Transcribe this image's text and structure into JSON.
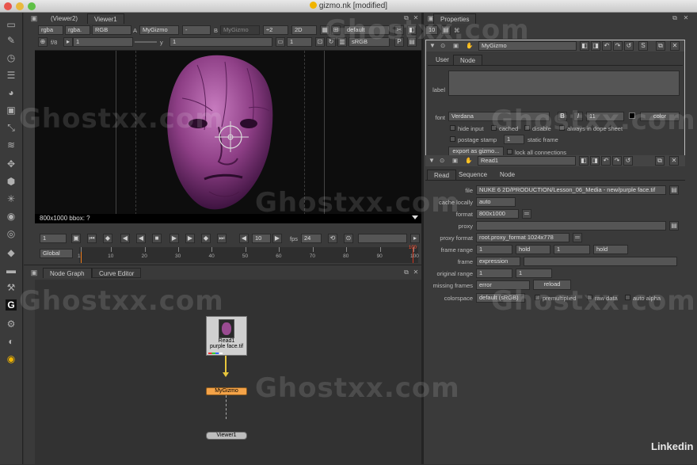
{
  "window": {
    "title": "gizmo.nk [modified]"
  },
  "viewer": {
    "tabs": [
      "(Viewer2)",
      "Viewer1"
    ],
    "row1": {
      "channels": "rgba",
      "alpha": "rgba.",
      "colorspace": "RGB",
      "a_label": "A",
      "a_input": "MyGizmo",
      "a_extra": "-",
      "b_label": "B",
      "b_input": "MyGizmo",
      "zoom": "÷2",
      "view": "2D",
      "lut_default": "default"
    },
    "row2": {
      "fstop": "f/8",
      "gain": "1",
      "y_label": "y",
      "gamma": "1",
      "proxy": "1",
      "display": "sRGB"
    },
    "info": "800x1000  bbox: ?"
  },
  "timeline": {
    "frame": "1",
    "step": "10",
    "fps_label": "fps",
    "fps": "24",
    "range_mode": "Global",
    "ticks": [
      "1",
      "10",
      "20",
      "30",
      "40",
      "50",
      "60",
      "70",
      "80",
      "90",
      "100"
    ],
    "end_marker": "100"
  },
  "graph": {
    "tabs": [
      "Node Graph",
      "Curve Editor"
    ],
    "nodes": {
      "read_name": "Read1",
      "read_file": "purple face.tif",
      "gizmo": "MyGizmo",
      "viewer": "Viewer1"
    }
  },
  "properties": {
    "title": "Properties",
    "max_panels": "10",
    "gizmo": {
      "name": "MyGizmo",
      "tabs": [
        "User",
        "Node"
      ],
      "label_label": "label",
      "font_label": "font",
      "font": "Verdana",
      "bold": "B",
      "italic": "I",
      "font_size": "11",
      "color_label": "color",
      "hide_input": "hide input",
      "cached": "cached",
      "disable": "disable",
      "dope_sheet": "always in dope sheet",
      "postage_stamp": "postage stamp",
      "static_frame_value": "1",
      "static_frame": "static frame",
      "export": "export as gizmo...",
      "lock": "lock all connections"
    },
    "read": {
      "name": "Read1",
      "tabs": [
        "Read",
        "Sequence",
        "Node"
      ],
      "file_label": "file",
      "file": "NUKE 6 2D/PRODUCTION/Lesson_06_Media - new/purple face.tif",
      "cache_label": "cache locally",
      "cache": "auto",
      "format_label": "format",
      "format": "800x1000",
      "proxy_label": "proxy",
      "proxy_format_label": "proxy format",
      "proxy_format": "root.proxy_format 1024x778",
      "frame_range_label": "frame range",
      "fr_start": "1",
      "fr_start_mode": "hold",
      "fr_end": "1",
      "fr_end_mode": "hold",
      "frame_label": "frame",
      "frame_mode": "expression",
      "orig_range_label": "original range",
      "or_start": "1",
      "or_end": "1",
      "missing_label": "missing frames",
      "missing": "error",
      "reload": "reload",
      "colorspace_label": "colorspace",
      "colorspace": "default (sRGB)",
      "premult": "premultiplied",
      "raw": "raw data",
      "auto_alpha": "auto alpha"
    }
  },
  "watermark": "Ghostxx.com",
  "brand": "Linkedin"
}
